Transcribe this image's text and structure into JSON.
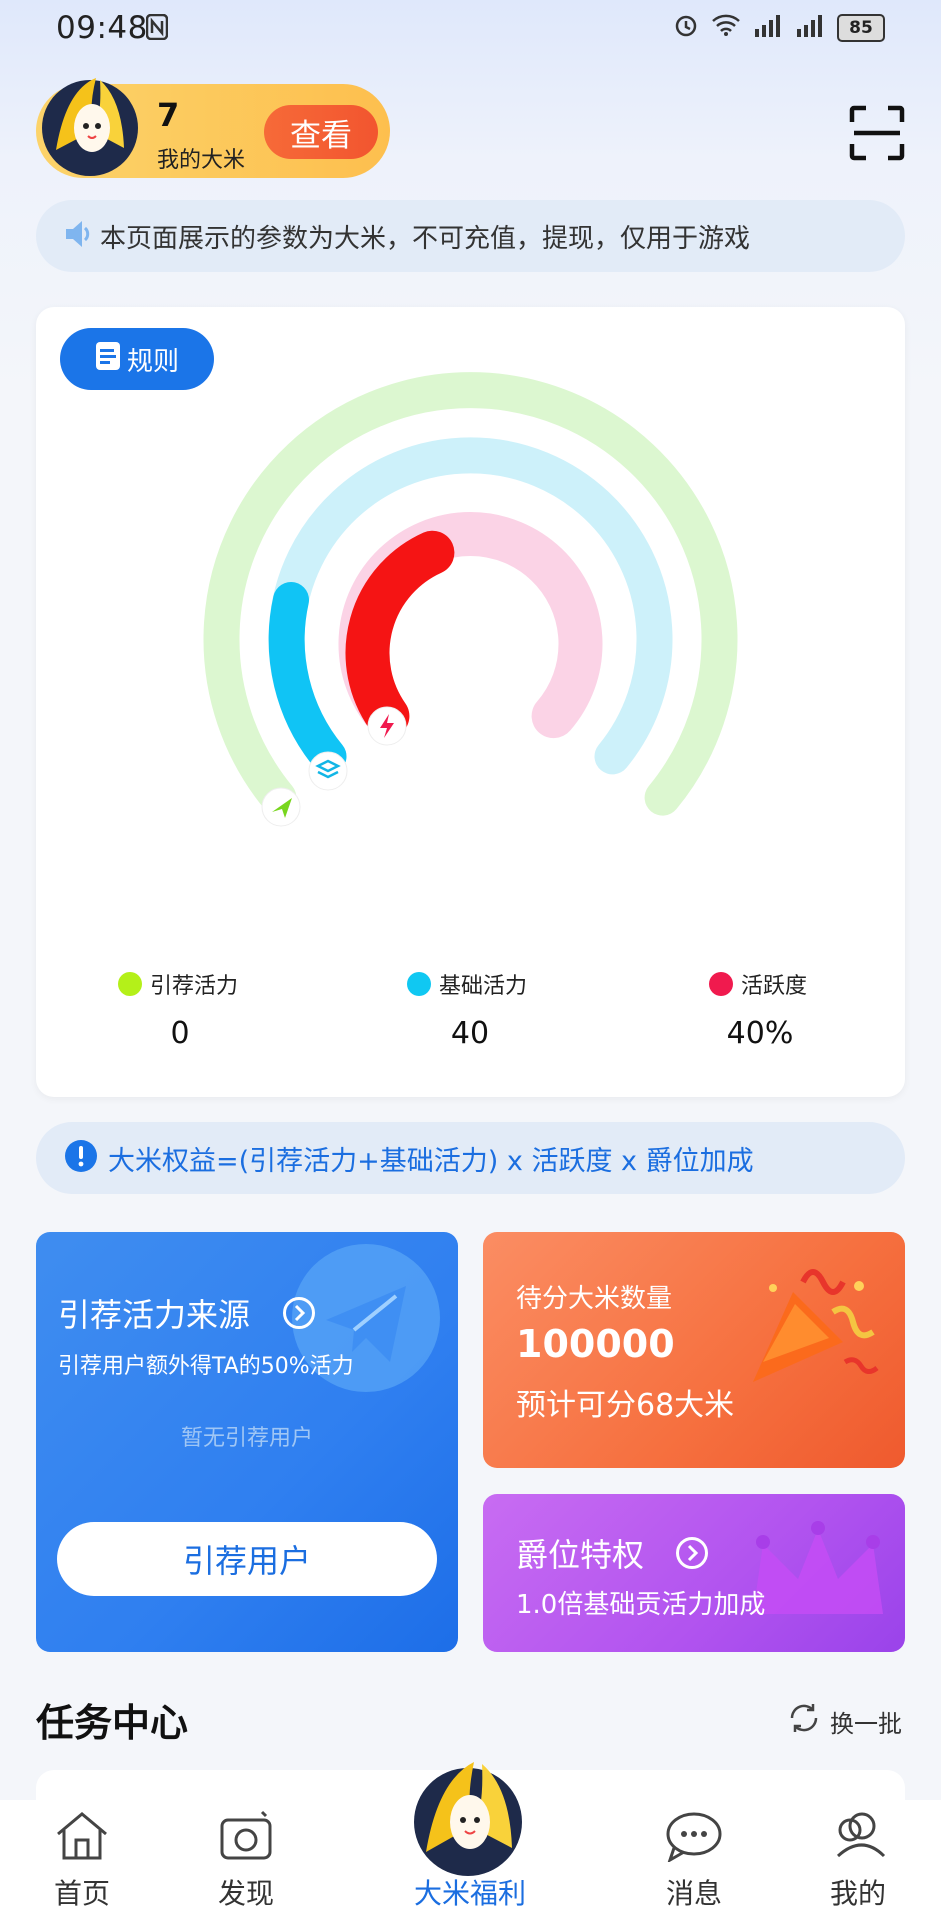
{
  "status_bar": {
    "time": "09:48",
    "battery": "85"
  },
  "header": {
    "rice_count": "7",
    "rice_label": "我的大米",
    "view_button": "查看"
  },
  "notice": {
    "text": "本页面展示的参数为大米，不可充值，提现，仅用于游戏"
  },
  "card": {
    "rule_button": "规则",
    "legend": [
      {
        "label": "引荐活力",
        "value": "0",
        "color": "#b4f019"
      },
      {
        "label": "基础活力",
        "value": "40",
        "color": "#10c8f2"
      },
      {
        "label": "活跃度",
        "value": "40%",
        "color": "#f01a4e"
      }
    ],
    "ring_colors": {
      "outer": "#dcf7d0",
      "middle": "#cdf1fa",
      "inner": "#fbd3e6",
      "middle_fill": "#10c4f5",
      "inner_fill": "#f51414"
    }
  },
  "formula": {
    "text": "大米权益=(引荐活力+基础活力) x 活跃度 x 爵位加成"
  },
  "referral_card": {
    "title": "引荐活力来源",
    "subtitle": "引荐用户额外得TA的50%活力",
    "empty_text": "暂无引荐用户",
    "button": "引荐用户"
  },
  "pending_card": {
    "title": "待分大米数量",
    "amount": "100000",
    "estimate": "预计可分68大米"
  },
  "rank_card": {
    "title": "爵位特权",
    "subtitle": "1.0倍基础贡活力加成"
  },
  "task_center": {
    "title": "任务中心",
    "refresh": "换一批"
  },
  "bottom_nav": [
    {
      "label": "首页",
      "icon": "home-icon"
    },
    {
      "label": "发现",
      "icon": "camera-icon"
    },
    {
      "label": "大米福利",
      "icon": "rice-mascot-icon"
    },
    {
      "label": "消息",
      "icon": "chat-icon"
    },
    {
      "label": "我的",
      "icon": "profile-icon"
    }
  ]
}
